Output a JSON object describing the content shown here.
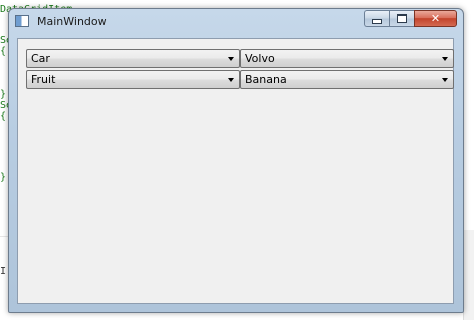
{
  "background_code": {
    "line1": "DataGridItem",
    "line2": "Se",
    "line3": "{",
    "line4": "}",
    "line5": "Se",
    "line6": "{",
    "line7": "}",
    "line8": "I("
  },
  "window": {
    "title": "MainWindow",
    "icon": "window-app-icon",
    "buttons": {
      "minimize": "minimize-icon",
      "maximize": "maximize-icon",
      "close_label": "✕"
    }
  },
  "combos": [
    {
      "value": "Car"
    },
    {
      "value": "Volvo"
    },
    {
      "value": "Fruit"
    },
    {
      "value": "Banana"
    }
  ]
}
